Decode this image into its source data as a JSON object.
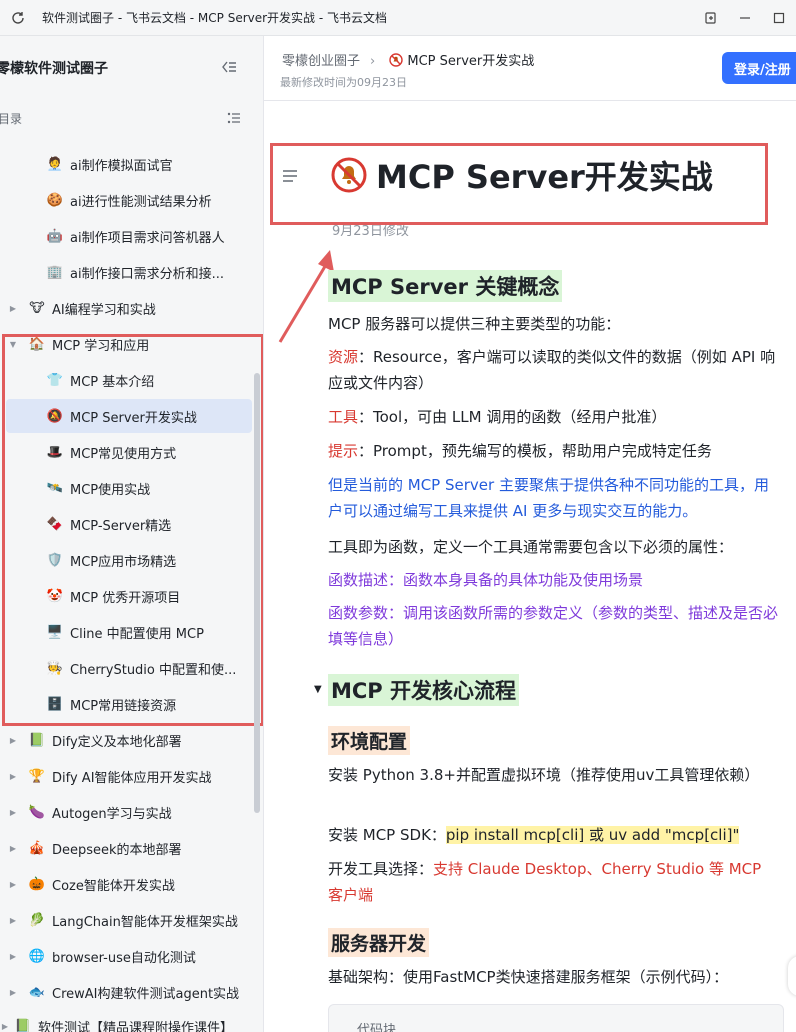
{
  "window": {
    "title": "软件测试圈子 - 飞书云文档 - MCP Server开发实战 - 飞书云文档"
  },
  "sidebar": {
    "space_name": "零檬软件测试圈子",
    "toc_label": "目录",
    "items": [
      {
        "label": "ai制作模拟面试官",
        "level": 2,
        "emoji": "🧑‍💼",
        "expanded": null
      },
      {
        "label": "ai进行性能测试结果分析",
        "level": 2,
        "emoji": "🍪",
        "expanded": null
      },
      {
        "label": "ai制作项目需求问答机器人",
        "level": 2,
        "emoji": "🤖",
        "expanded": null
      },
      {
        "label": "ai制作接口需求分析和接...",
        "level": 2,
        "emoji": "🏢",
        "expanded": null
      },
      {
        "label": "AI编程学习和实战",
        "level": 1,
        "emoji": "🐮",
        "expanded": false
      },
      {
        "label": "MCP 学习和应用",
        "level": 1,
        "emoji": "🏠",
        "expanded": true
      },
      {
        "label": "MCP 基本介绍",
        "level": 2,
        "emoji": "👕",
        "expanded": null
      },
      {
        "label": "MCP Server开发实战",
        "level": 2,
        "emoji": "🔕",
        "expanded": null,
        "active": true
      },
      {
        "label": "MCP常见使用方式",
        "level": 2,
        "emoji": "🎩",
        "expanded": null
      },
      {
        "label": "MCP使用实战",
        "level": 2,
        "emoji": "🛰️",
        "expanded": null
      },
      {
        "label": "MCP-Server精选",
        "level": 2,
        "emoji": "🍫",
        "expanded": null
      },
      {
        "label": "MCP应用市场精选",
        "level": 2,
        "emoji": "🛡️",
        "expanded": null
      },
      {
        "label": "MCP 优秀开源项目",
        "level": 2,
        "emoji": "🤡",
        "expanded": null
      },
      {
        "label": "Cline 中配置使用 MCP",
        "level": 2,
        "emoji": "🖥️",
        "expanded": null
      },
      {
        "label": "CherryStudio 中配置和使...",
        "level": 2,
        "emoji": "🧑‍🍳",
        "expanded": null
      },
      {
        "label": "MCP常用链接资源",
        "level": 2,
        "emoji": "🗄️",
        "expanded": null
      },
      {
        "label": "Dify定义及本地化部署",
        "level": 1,
        "emoji": "📗",
        "expanded": false
      },
      {
        "label": "Dify AI智能体应用开发实战",
        "level": 1,
        "emoji": "🏆",
        "expanded": false
      },
      {
        "label": "Autogen学习与实战",
        "level": 1,
        "emoji": "🍆",
        "expanded": false
      },
      {
        "label": "Deepseek的本地部署",
        "level": 1,
        "emoji": "🎪",
        "expanded": false
      },
      {
        "label": "Coze智能体开发实战",
        "level": 1,
        "emoji": "🎃",
        "expanded": false
      },
      {
        "label": "LangChain智能体开发框架实战",
        "level": 1,
        "emoji": "🥬",
        "expanded": false
      },
      {
        "label": "browser-use自动化测试",
        "level": 1,
        "emoji": "🌐",
        "expanded": false
      },
      {
        "label": "CrewAI构建软件测试agent实战",
        "level": 1,
        "emoji": "🐟",
        "expanded": false
      },
      {
        "label": "软件测试【精品课程附操作课件】",
        "level": 0,
        "emoji": "📗",
        "expanded": false
      }
    ]
  },
  "header": {
    "breadcrumb_parent": "零檬创业圈子",
    "breadcrumb_current": "MCP Server开发实战",
    "modified": "最新修改时间为09月23日",
    "login_label": "登录/注册"
  },
  "doc": {
    "title": "MCP Server开发实战",
    "date": "9月23日修改",
    "h_concepts": "MCP Server 关键概念",
    "p_intro": "MCP 服务器可以提供三种主要类型的功能：",
    "resource_key": "资源",
    "resource_text": "：Resource，客户端可以读取的类似文件的数据（例如 API 响应或文件内容）",
    "tool_key": "工具",
    "tool_text": "：Tool，可由 LLM 调用的函数（经用户批准）",
    "prompt_key": "提示",
    "prompt_text": "：Prompt，预先编写的模板，帮助用户完成特定任务",
    "blue_note": "但是当前的 MCP Server 主要聚焦于提供各种不同功能的工具，用户可以通过编写工具来提供 AI 更多与现实交互的能力。",
    "p_tools": "工具即为函数，定义一个工具通常需要包含以下必须的属性：",
    "func_desc": "函数描述：函数本身具备的具体功能及使用场景",
    "func_params": "函数参数：调用该函数所需的参数定义（参数的类型、描述及是否必填等信息）",
    "h_flow": "MCP 开发核心流程",
    "h_env": "环境配置",
    "env_python": "安装 Python 3.8+并配置虚拟环境（推荐使用uv工具管理依赖）",
    "env_sdk_prefix": "安装 MCP SDK：",
    "env_sdk_cmd": "pip install mcp[cli] 或 uv add \"mcp[cli]\"",
    "env_tools_prefix": "开发工具选择：",
    "env_tools_text": "支持 Claude Desktop、Cherry Studio 等 MCP 客户端",
    "h_server": "服务器开发",
    "server_arch": "基础架构：使用FastMCP类快速搭建服务框架（示例代码）：",
    "code_label": "代码块"
  },
  "colors": {
    "accent": "#3370ff",
    "annotation_red": "#e05c5c",
    "active_bg": "#dde6f7"
  }
}
